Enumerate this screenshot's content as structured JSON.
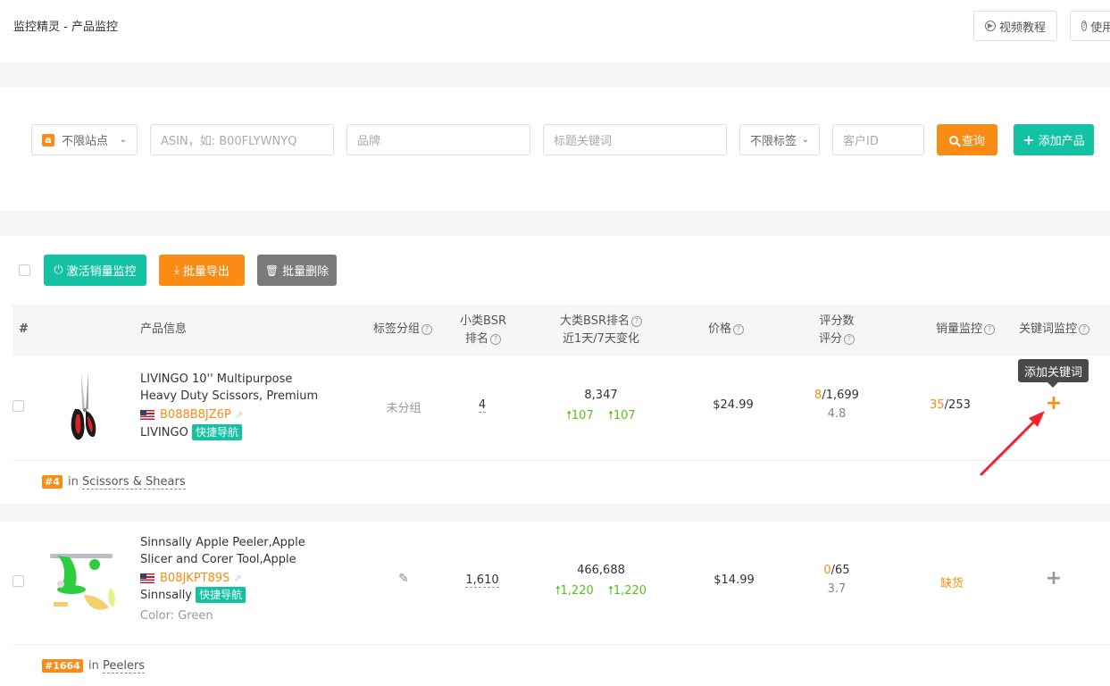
{
  "header": {
    "title": "监控精灵 - 产品监控",
    "video_tutorial": "视频教程",
    "usage": "使用"
  },
  "filters": {
    "site_select": "不限站点",
    "asin_placeholder": "ASIN，如: B00FLYWNYQ",
    "brand_placeholder": "品牌",
    "keyword_placeholder": "标题关键词",
    "tag_select": "不限标签",
    "customer_placeholder": "客户ID",
    "query_label": "查询",
    "add_product_label": "添加产品"
  },
  "actions": {
    "activate": "激活销量监控",
    "export": "批量导出",
    "delete": "批量删除"
  },
  "columns": {
    "index": "#",
    "product": "产品信息",
    "tag_group": "标签分组",
    "sub_bsr_1": "小类BSR",
    "sub_bsr_2": "排名",
    "main_bsr_1": "大类BSR排名",
    "main_bsr_2": "近1天/7天变化",
    "price": "价格",
    "rating_1": "评分数",
    "rating_2": "评分",
    "sales": "销量监控",
    "keyword": "关键词监控"
  },
  "tooltip": "添加关键词",
  "colors": {
    "orange": "#fa8c16",
    "teal": "#13c2a3",
    "green": "#52c41a"
  },
  "rows": [
    {
      "title_1": "LIVINGO 10'' Multipurpose",
      "title_2": "Heavy Duty Scissors, Premium",
      "asin": "B088B8JZ6P",
      "brand": "LIVINGO",
      "nav_tag": "快捷导航",
      "group": "未分组",
      "sub_bsr": "4",
      "main_bsr": "8,347",
      "change_1d": "107",
      "change_7d": "107",
      "price": "$24.99",
      "rating_count_new": "8",
      "rating_count_total": "/1,699",
      "rating": "4.8",
      "sales_new": "35",
      "sales_total": "/253",
      "keyword_icon": "plus-icon",
      "rank_badge": "#4",
      "rank_in": "in",
      "rank_category": "Scissors & Shears"
    },
    {
      "title_1": "Sinnsally Apple Peeler,Apple",
      "title_2": "Slicer and Corer Tool,Apple",
      "asin": "B08JKPT89S",
      "brand": "Sinnsally",
      "nav_tag": "快捷导航",
      "color": "Color: Green",
      "sub_bsr": "1,610",
      "main_bsr": "466,688",
      "change_1d": "1,220",
      "change_7d": "1,220",
      "price": "$14.99",
      "rating_count_new": "0",
      "rating_count_total": "/65",
      "rating": "3.7",
      "sales_status": "缺货",
      "keyword_icon": "plus-icon",
      "rank_badge": "#1664",
      "rank_in": "in",
      "rank_category": "Peelers"
    }
  ]
}
